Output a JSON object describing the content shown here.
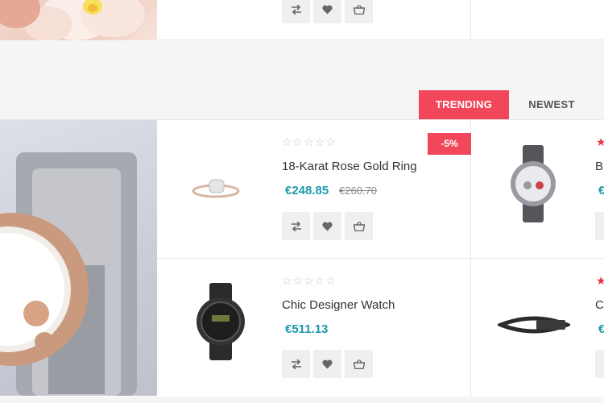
{
  "tabs": [
    {
      "label": "TRENDING",
      "active": true
    },
    {
      "label": "NEWEST",
      "active": false
    }
  ],
  "products": [
    {
      "name": "18-Karat Rose Gold Ring",
      "price": "€248.85",
      "old_price": "€260.70",
      "badge": "-5%",
      "rating": 0
    },
    {
      "name": "Chic Designer Watch",
      "price": "€511.13",
      "rating": 0
    },
    {
      "name": "Br",
      "price": "€",
      "rating": 1
    },
    {
      "name": "Cu",
      "price": "€",
      "rating": 1
    }
  ],
  "actions": {
    "compare": "compare-icon",
    "wishlist": "heart-icon",
    "cart": "basket-icon"
  },
  "colors": {
    "accent": "#f2475b",
    "price": "#1b9aaa",
    "star_active": "#e8343f"
  }
}
